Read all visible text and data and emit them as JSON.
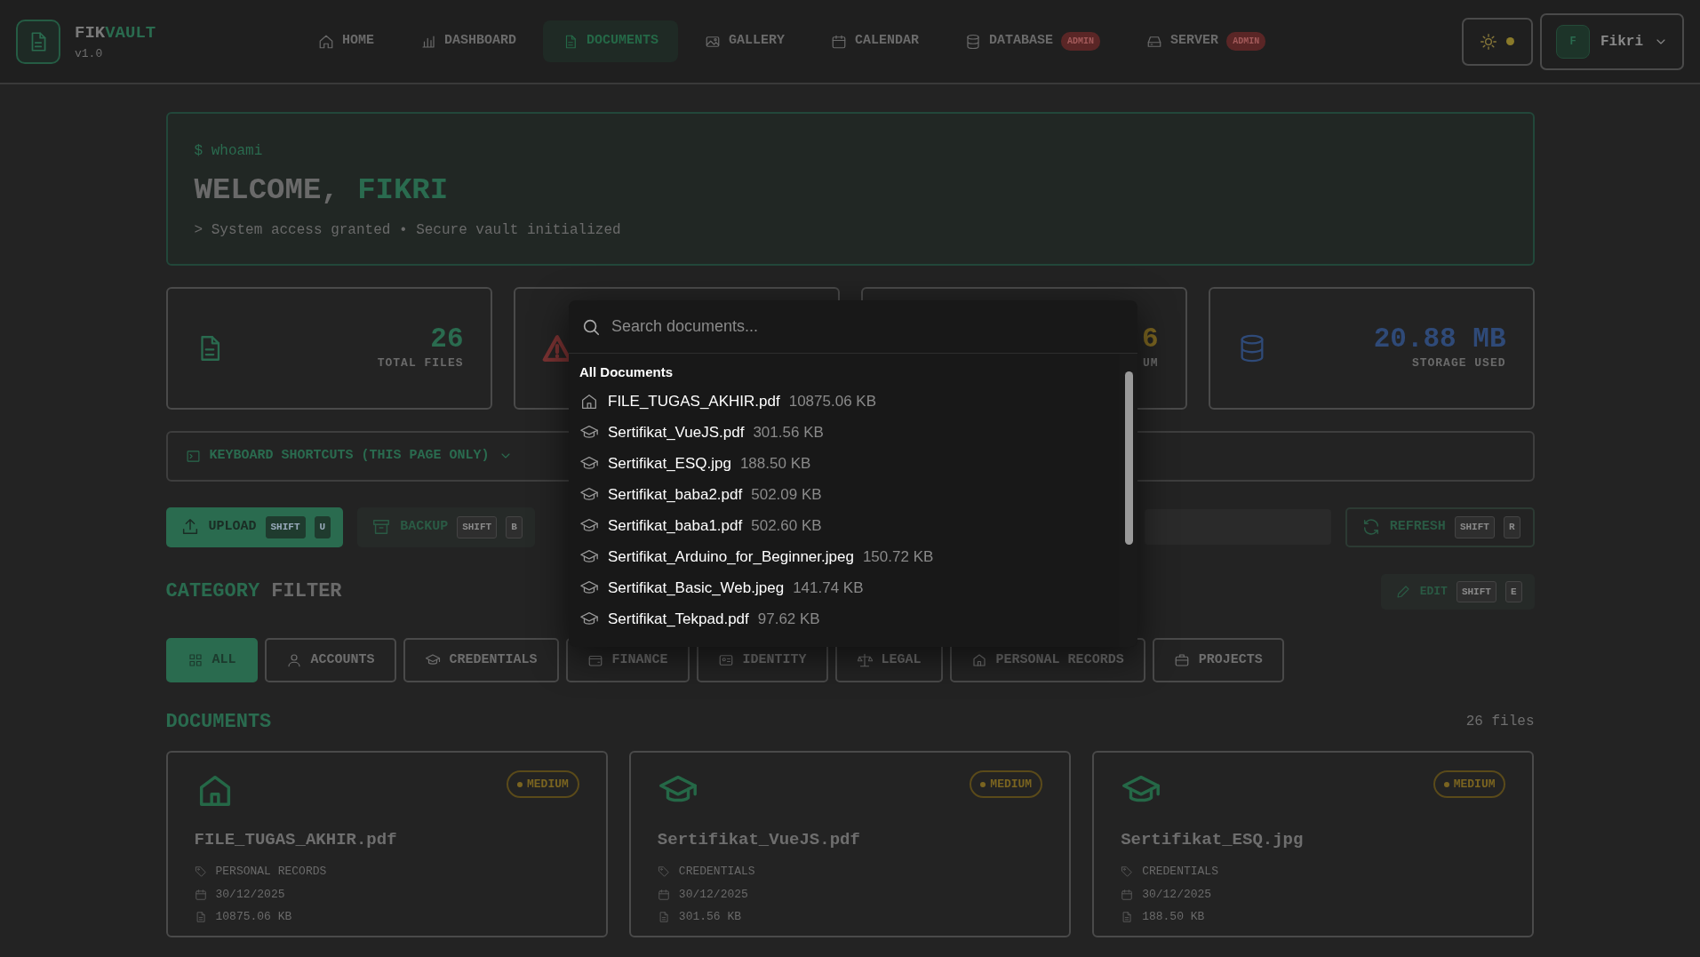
{
  "brand": {
    "name_lead": "FIK",
    "name_tail": "VAULT",
    "version": "v1.0"
  },
  "nav": [
    {
      "label": "HOME",
      "selected": false
    },
    {
      "label": "DASHBOARD",
      "selected": false
    },
    {
      "label": "DOCUMENTS",
      "selected": true
    },
    {
      "label": "GALLERY",
      "selected": false
    },
    {
      "label": "CALENDAR",
      "selected": false
    },
    {
      "label": "DATABASE",
      "selected": false,
      "badge": "ADMIN"
    },
    {
      "label": "SERVER",
      "selected": false,
      "badge": "ADMIN"
    }
  ],
  "theme_toggle": {
    "on": true
  },
  "user": {
    "initial": "F",
    "name": "Fikri"
  },
  "welcome": {
    "prompt": "$ whoami",
    "greeting": "WELCOME,",
    "name": "FIKRI",
    "status": "> System access granted • Secure vault initialized"
  },
  "stats": [
    {
      "value": "26",
      "label": "TOTAL FILES",
      "color": "#2a6b4f"
    },
    {
      "color": "#7a3232"
    },
    {
      "value": "6",
      "label": "UM",
      "color": "#7a6420"
    },
    {
      "value": "20.88 MB",
      "label": "STORAGE USED",
      "color": "#2f4a78"
    }
  ],
  "shortcuts": {
    "label": "KEYBOARD SHORTCUTS (THIS PAGE ONLY)",
    "expanded": false
  },
  "actions": [
    {
      "label": "UPLOAD",
      "keys": [
        "SHIFT",
        "U"
      ],
      "kind": "primary"
    },
    {
      "label": "BACKUP",
      "keys": [
        "SHIFT",
        "B"
      ],
      "kind": "muted"
    }
  ],
  "refresh": {
    "label": "REFRESH",
    "keys": [
      "SHIFT",
      "R"
    ]
  },
  "category_title": {
    "lead": "CATEGORY",
    "tail": "FILTER"
  },
  "edit": {
    "label": "EDIT",
    "keys": [
      "SHIFT",
      "E"
    ]
  },
  "filters": [
    {
      "label": "ALL",
      "selected": true
    },
    {
      "label": "ACCOUNTS",
      "selected": false
    },
    {
      "label": "CREDENTIALS",
      "selected": false
    },
    {
      "label": "FINANCE",
      "selected": false
    },
    {
      "label": "IDENTITY",
      "selected": false
    },
    {
      "label": "LEGAL",
      "selected": false
    },
    {
      "label": "PERSONAL RECORDS",
      "selected": false
    },
    {
      "label": "PROJECTS",
      "selected": false
    }
  ],
  "documents": {
    "title": "DOCUMENTS",
    "count": "26 files",
    "cards": [
      {
        "name": "FILE_TUGAS_AKHIR.pdf",
        "category": "PERSONAL RECORDS",
        "date": "30/12/2025",
        "size": "10875.06 KB",
        "priority": "MEDIUM"
      },
      {
        "name": "Sertifikat_VueJS.pdf",
        "category": "CREDENTIALS",
        "date": "30/12/2025",
        "size": "301.56 KB",
        "priority": "MEDIUM"
      },
      {
        "name": "Sertifikat_ESQ.jpg",
        "category": "CREDENTIALS",
        "date": "30/12/2025",
        "size": "188.50 KB",
        "priority": "MEDIUM"
      }
    ]
  },
  "search_palette": {
    "placeholder": "Search documents...",
    "group": "All Documents",
    "results": [
      {
        "name": "FILE_TUGAS_AKHIR.pdf",
        "size": "10875.06 KB"
      },
      {
        "name": "Sertifikat_VueJS.pdf",
        "size": "301.56 KB"
      },
      {
        "name": "Sertifikat_ESQ.jpg",
        "size": "188.50 KB"
      },
      {
        "name": "Sertifikat_baba2.pdf",
        "size": "502.09 KB"
      },
      {
        "name": "Sertifikat_baba1.pdf",
        "size": "502.60 KB"
      },
      {
        "name": "Sertifikat_Arduino_for_Beginner.jpeg",
        "size": "150.72 KB"
      },
      {
        "name": "Sertifikat_Basic_Web.jpeg",
        "size": "141.74 KB"
      },
      {
        "name": "Sertifikat_Tekpad.pdf",
        "size": "97.62 KB"
      }
    ]
  }
}
